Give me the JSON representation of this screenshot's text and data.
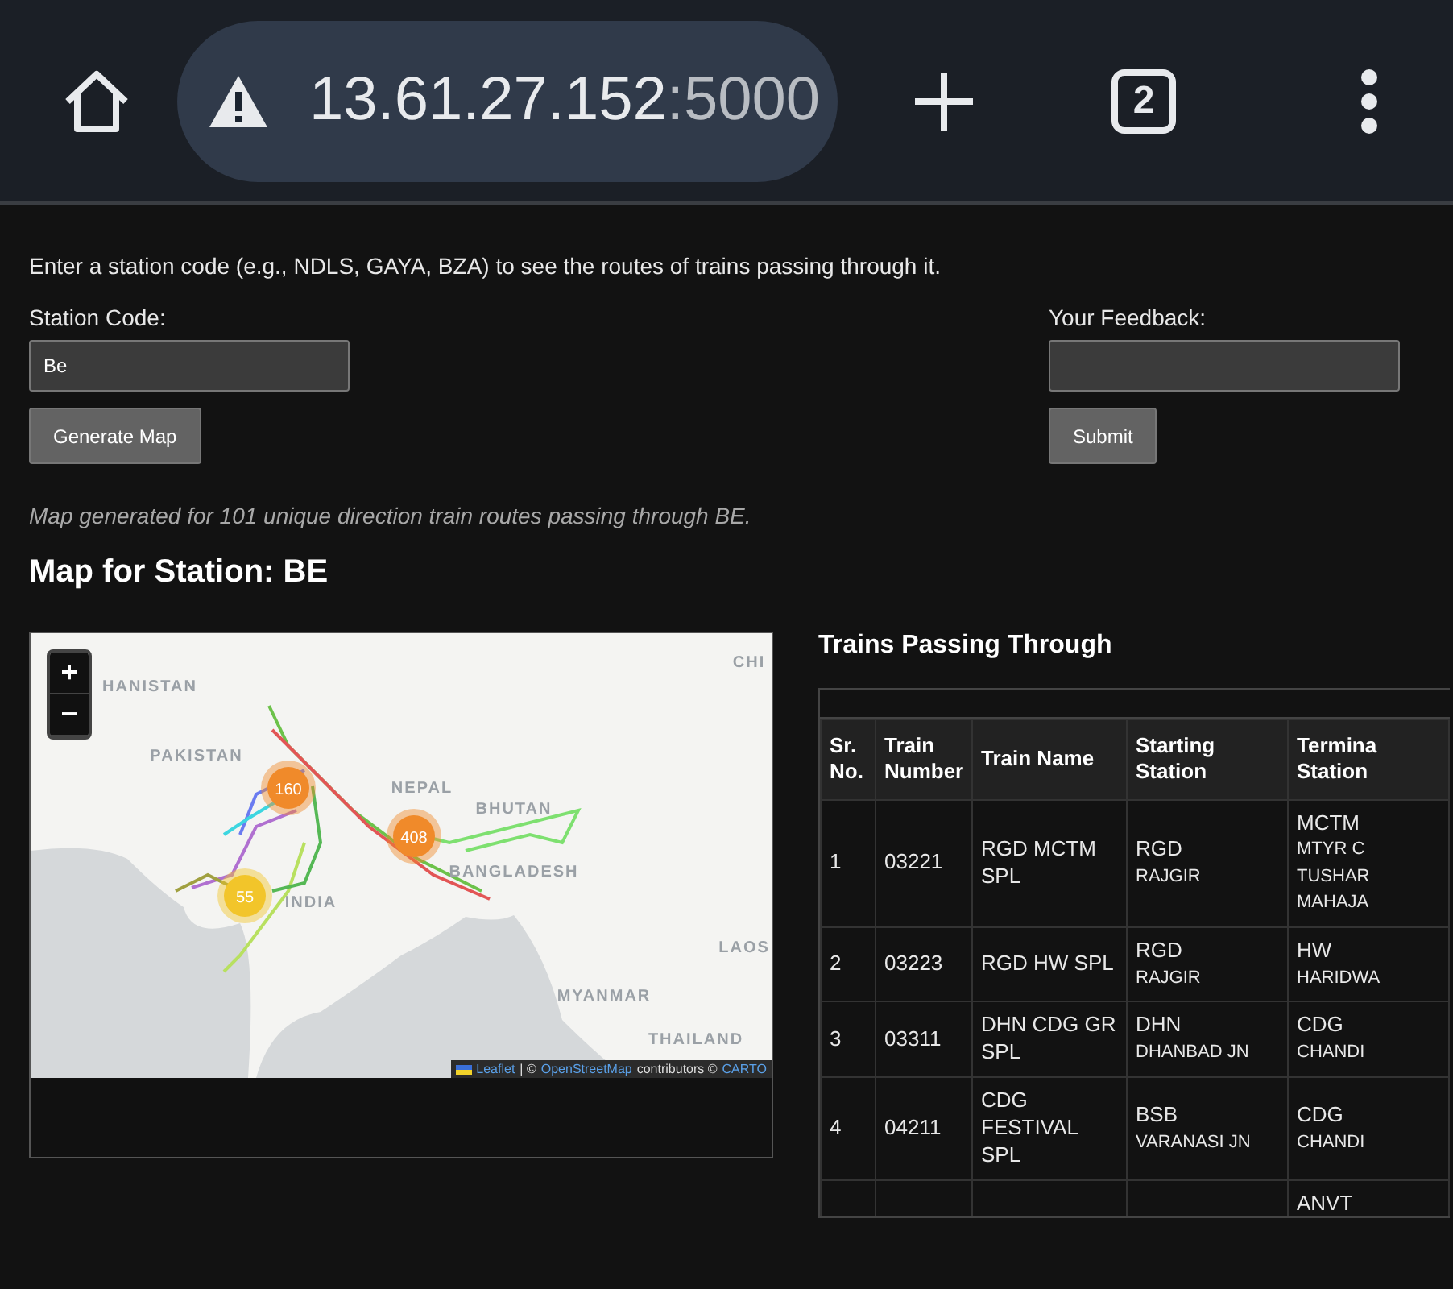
{
  "browser": {
    "url_host": "13.61.27.152",
    "url_port": ":5000",
    "tab_count": "2"
  },
  "intro": "Enter a station code (e.g., NDLS, GAYA, BZA) to see the routes of trains passing through it.",
  "station_form": {
    "label": "Station Code:",
    "value": "Be",
    "button": "Generate Map"
  },
  "feedback_form": {
    "label": "Your Feedback:",
    "button": "Submit"
  },
  "status_message": "Map generated for 101 unique direction train routes passing through BE.",
  "map_heading": "Map for Station: BE",
  "map": {
    "zoom_in": "+",
    "zoom_out": "−",
    "labels": [
      "HANISTAN",
      "CHI",
      "PAKISTAN",
      "NEPAL",
      "BHUTAN",
      "BANGLADESH",
      "INDIA",
      "LAOS",
      "MYANMAR",
      "THAILAND"
    ],
    "clusters": [
      {
        "count": "160",
        "color": "#f08a2a"
      },
      {
        "count": "408",
        "color": "#f08a2a"
      },
      {
        "count": "55",
        "color": "#f2c52a"
      }
    ],
    "attribution": {
      "leaflet": "Leaflet",
      "separator": "| ©",
      "osm": "OpenStreetMap",
      "contributors": "contributors ©",
      "carto": "CARTO"
    }
  },
  "trains": {
    "title": "Trains Passing Through",
    "columns": [
      "Sr.\nNo.",
      "Train\nNumber",
      "Train Name",
      "Starting\nStation",
      "Termina\nStation"
    ],
    "rows": [
      {
        "sr": "1",
        "number": "03221",
        "name": "RGD MCTM SPL",
        "start_code": "RGD",
        "start_name": "RAJGIR",
        "end_code": "MCTM",
        "end_name": "MTYR C\nTUSHAR\nMAHAJA"
      },
      {
        "sr": "2",
        "number": "03223",
        "name": "RGD HW SPL",
        "start_code": "RGD",
        "start_name": "RAJGIR",
        "end_code": "HW",
        "end_name": "HARIDWA"
      },
      {
        "sr": "3",
        "number": "03311",
        "name": "DHN CDG GR SPL",
        "start_code": "DHN",
        "start_name": "DHANBAD JN",
        "end_code": "CDG",
        "end_name": "CHANDI"
      },
      {
        "sr": "4",
        "number": "04211",
        "name": "CDG FESTIVAL SPL",
        "start_code": "BSB",
        "start_name": "VARANASI JN",
        "end_code": "CDG",
        "end_name": "CHANDI"
      },
      {
        "end_code": "ANVT"
      }
    ]
  }
}
